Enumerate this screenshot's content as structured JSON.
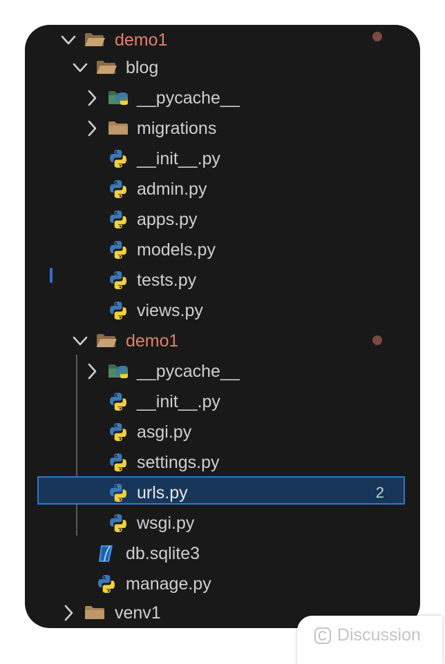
{
  "explorer": {
    "items": [
      {
        "label": "demo1",
        "kind": "folder",
        "expanded": true,
        "modified": true,
        "dot": true
      },
      {
        "label": "blog",
        "kind": "folder",
        "expanded": true,
        "modified": false
      },
      {
        "label": "__pycache__",
        "kind": "pycache",
        "expanded": false,
        "modified": false
      },
      {
        "label": "migrations",
        "kind": "folder",
        "expanded": false,
        "modified": false
      },
      {
        "label": "__init__.py",
        "kind": "python",
        "modified": false
      },
      {
        "label": "admin.py",
        "kind": "python",
        "modified": false
      },
      {
        "label": "apps.py",
        "kind": "python",
        "modified": false
      },
      {
        "label": "models.py",
        "kind": "python",
        "modified": false
      },
      {
        "label": "tests.py",
        "kind": "python",
        "modified": false
      },
      {
        "label": "views.py",
        "kind": "python",
        "modified": false
      },
      {
        "label": "demo1",
        "kind": "folder",
        "expanded": true,
        "modified": true,
        "dot": true
      },
      {
        "label": "__pycache__",
        "kind": "pycache",
        "expanded": false,
        "modified": false
      },
      {
        "label": "__init__.py",
        "kind": "python",
        "modified": false
      },
      {
        "label": "asgi.py",
        "kind": "python",
        "modified": false
      },
      {
        "label": "settings.py",
        "kind": "python",
        "modified": false
      },
      {
        "label": "urls.py",
        "kind": "python",
        "modified": false,
        "selected": true,
        "badge": "2"
      },
      {
        "label": "wsgi.py",
        "kind": "python",
        "modified": false
      },
      {
        "label": "db.sqlite3",
        "kind": "sqlite",
        "modified": false
      },
      {
        "label": "manage.py",
        "kind": "python",
        "modified": false
      },
      {
        "label": "venv1",
        "kind": "folder",
        "expanded": false,
        "modified": false
      }
    ]
  },
  "discussion": {
    "label": "Discussion"
  },
  "colors": {
    "background": "#191919",
    "text": "#cfcfcf",
    "modified": "#e0806a",
    "selection": "#18365a",
    "selection_border": "#2f78c8"
  }
}
